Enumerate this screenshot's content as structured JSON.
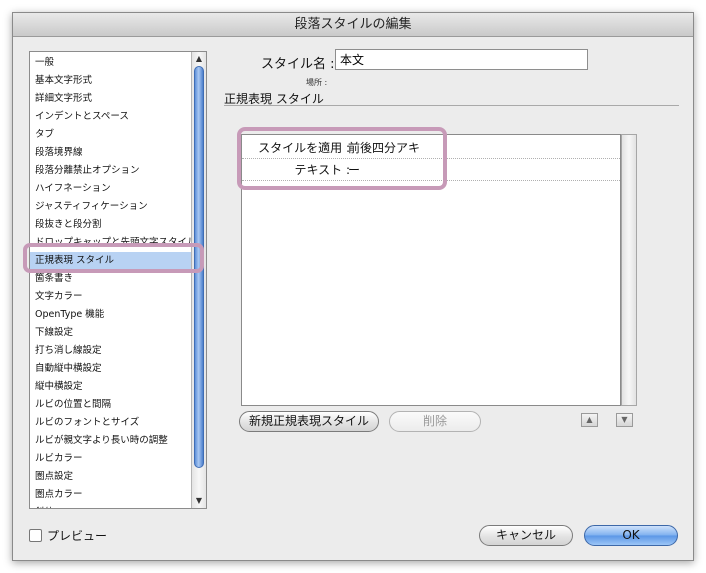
{
  "dialog": {
    "title": "段落スタイルの編集"
  },
  "sidebar": {
    "items": [
      "一般",
      "基本文字形式",
      "詳細文字形式",
      "インデントとスペース",
      "タブ",
      "段落境界線",
      "段落分離禁止オプション",
      "ハイフネーション",
      "ジャスティフィケーション",
      "段抜きと段分割",
      "ドロップキャップと先頭文字スタイル",
      "正規表現 スタイル",
      "箇条書き",
      "文字カラー",
      "OpenType 機能",
      "下線設定",
      "打ち消し線設定",
      "自動縦中横設定",
      "縦中横設定",
      "ルビの位置と間隔",
      "ルビのフォントとサイズ",
      "ルビが親文字より長い時の調整",
      "ルビカラー",
      "圏点設定",
      "圏点カラー",
      "斜体"
    ],
    "selected_index": 11,
    "scroll_up_icon": "triangle-up-icon",
    "scroll_down_icon": "triangle-down-icon"
  },
  "preview": {
    "label": "プレビュー",
    "checked": false
  },
  "form": {
    "style_name_label": "スタイル名 :",
    "style_name_value": "本文",
    "location_label": "場所 :",
    "section_title": "正規表現 スタイル"
  },
  "regex_rules": [
    {
      "label": "スタイルを適用 :",
      "value": "前後四分アキ"
    },
    {
      "label": "テキスト :",
      "value": "ー"
    }
  ],
  "buttons": {
    "new_regex": "新規正規表現スタイル",
    "delete": "削除",
    "cancel": "キャンセル",
    "ok": "OK",
    "move_up_icon": "▲",
    "move_down_icon": "▼"
  },
  "colors": {
    "highlight": "#c79ab8",
    "selection": "#b8d2f3",
    "ok_button": "#5a96e6"
  }
}
